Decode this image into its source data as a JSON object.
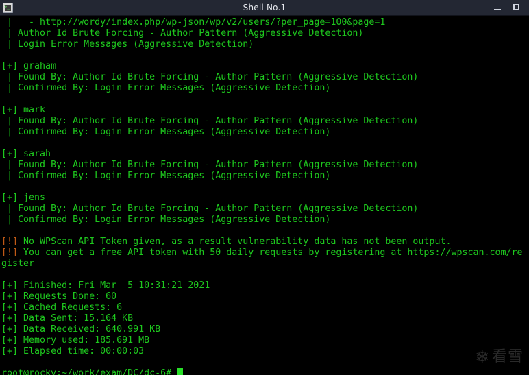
{
  "window": {
    "title": "Shell No.1",
    "icon": "terminal-icon",
    "controls": {
      "minimize_label": "Minimize",
      "maximize_label": "Maximize"
    }
  },
  "colors": {
    "titlebar_bg": "#232733",
    "titlebar_fg": "#e6e8ee",
    "terminal_bg": "#000000",
    "terminal_green": "#1ec81e",
    "warn_orange": "#c05a16",
    "cursor_green": "#28e028",
    "watermark": "#2a2a2a"
  },
  "watermark": {
    "flake": "❄",
    "text": "看雪"
  },
  "prompt": {
    "text": "root@rocky:~/work/exam/DC/dc-6#",
    "user": "root",
    "host": "rocky",
    "cwd": "~/work/exam/DC/dc-6",
    "symbol": "#"
  },
  "terminal": {
    "lines": [
      {
        "type": "pipe",
        "pipe": "|",
        "indent": 1,
        "text": "   - http://wordy/index.php/wp-json/wp/v2/users/?per_page=100&page=1"
      },
      {
        "type": "pipe",
        "pipe": "|",
        "indent": 1,
        "text": " Author Id Brute Forcing - Author Pattern (Aggressive Detection)"
      },
      {
        "type": "pipe",
        "pipe": "|",
        "indent": 1,
        "text": " Login Error Messages (Aggressive Detection)"
      },
      {
        "type": "blank",
        "text": ""
      },
      {
        "type": "plus",
        "prefix": "[+]",
        "text": " graham"
      },
      {
        "type": "pipe",
        "pipe": "|",
        "indent": 1,
        "text": " Found By: Author Id Brute Forcing - Author Pattern (Aggressive Detection)"
      },
      {
        "type": "pipe",
        "pipe": "|",
        "indent": 1,
        "text": " Confirmed By: Login Error Messages (Aggressive Detection)"
      },
      {
        "type": "blank",
        "text": ""
      },
      {
        "type": "plus",
        "prefix": "[+]",
        "text": " mark"
      },
      {
        "type": "pipe",
        "pipe": "|",
        "indent": 1,
        "text": " Found By: Author Id Brute Forcing - Author Pattern (Aggressive Detection)"
      },
      {
        "type": "pipe",
        "pipe": "|",
        "indent": 1,
        "text": " Confirmed By: Login Error Messages (Aggressive Detection)"
      },
      {
        "type": "blank",
        "text": ""
      },
      {
        "type": "plus",
        "prefix": "[+]",
        "text": " sarah"
      },
      {
        "type": "pipe",
        "pipe": "|",
        "indent": 1,
        "text": " Found By: Author Id Brute Forcing - Author Pattern (Aggressive Detection)"
      },
      {
        "type": "pipe",
        "pipe": "|",
        "indent": 1,
        "text": " Confirmed By: Login Error Messages (Aggressive Detection)"
      },
      {
        "type": "blank",
        "text": ""
      },
      {
        "type": "plus",
        "prefix": "[+]",
        "text": " jens"
      },
      {
        "type": "pipe",
        "pipe": "|",
        "indent": 1,
        "text": " Found By: Author Id Brute Forcing - Author Pattern (Aggressive Detection)"
      },
      {
        "type": "pipe",
        "pipe": "|",
        "indent": 1,
        "text": " Confirmed By: Login Error Messages (Aggressive Detection)"
      },
      {
        "type": "blank",
        "text": ""
      },
      {
        "type": "warn",
        "prefix": "[!]",
        "text": " No WPScan API Token given, as a result vulnerability data has not been output."
      },
      {
        "type": "warn",
        "prefix": "[!]",
        "text": " You can get a free API token with 50 daily requests by registering at https://wpscan.com/re"
      },
      {
        "type": "plain",
        "text": "gister"
      },
      {
        "type": "blank",
        "text": ""
      },
      {
        "type": "plus",
        "prefix": "[+]",
        "text": " Finished: Fri Mar  5 10:31:21 2021"
      },
      {
        "type": "plus",
        "prefix": "[+]",
        "text": " Requests Done: 60"
      },
      {
        "type": "plus",
        "prefix": "[+]",
        "text": " Cached Requests: 6"
      },
      {
        "type": "plus",
        "prefix": "[+]",
        "text": " Data Sent: 15.164 KB"
      },
      {
        "type": "plus",
        "prefix": "[+]",
        "text": " Data Received: 640.991 KB"
      },
      {
        "type": "plus",
        "prefix": "[+]",
        "text": " Memory used: 185.691 MB"
      },
      {
        "type": "plus",
        "prefix": "[+]",
        "text": " Elapsed time: 00:00:03"
      },
      {
        "type": "blank",
        "text": ""
      }
    ]
  }
}
